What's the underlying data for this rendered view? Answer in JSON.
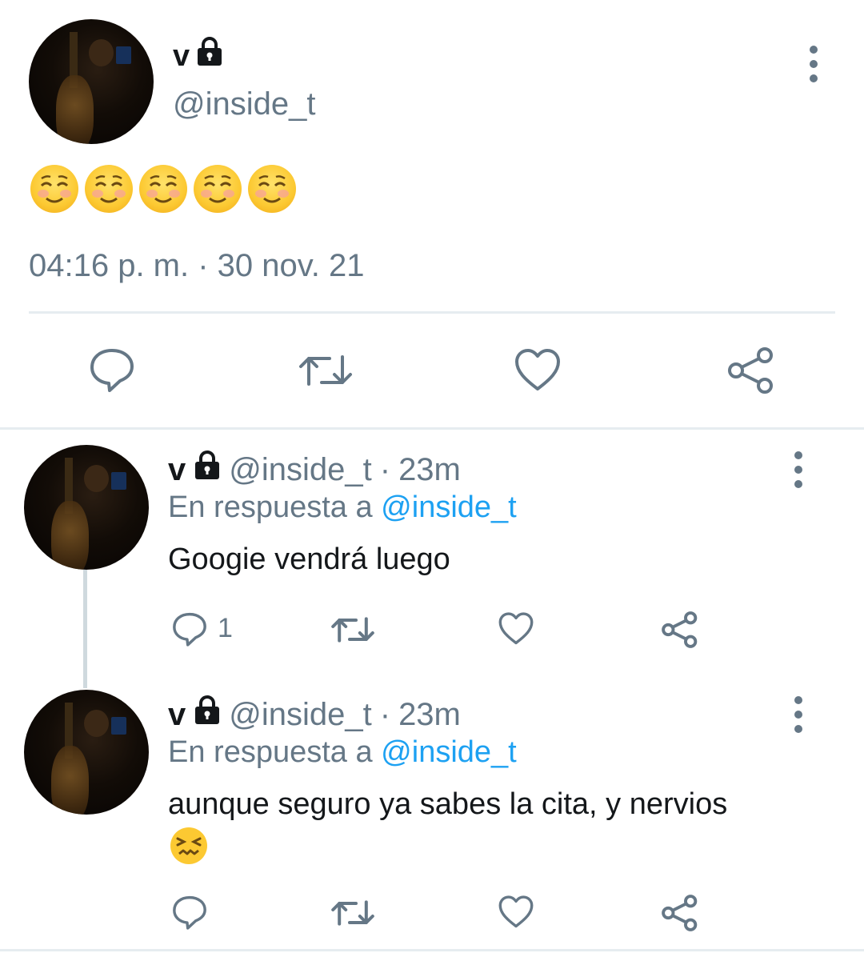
{
  "main_tweet": {
    "name": "v",
    "handle": "@inside_t",
    "emoji_text": "☺️☺️☺️☺️☺️",
    "timestamp": "04:16 p. m. · 30 nov. 21"
  },
  "replies": [
    {
      "name": "v",
      "handle": "@inside_t",
      "separator": "·",
      "time": "23m",
      "in_reply_prefix": "En respuesta a",
      "in_reply_mention": "@inside_t",
      "text": "Googie vendrá luego",
      "reply_count": "1"
    },
    {
      "name": "v",
      "handle": "@inside_t",
      "separator": "·",
      "time": "23m",
      "in_reply_prefix": "En respuesta a",
      "in_reply_mention": "@inside_t",
      "text": "aunque seguro ya sabes la cita, y nervios",
      "emoji": "😖",
      "reply_count": ""
    }
  ],
  "colors": {
    "secondary_text": "#657786",
    "link": "#1da1f2",
    "divider": "#e6ecf0"
  }
}
